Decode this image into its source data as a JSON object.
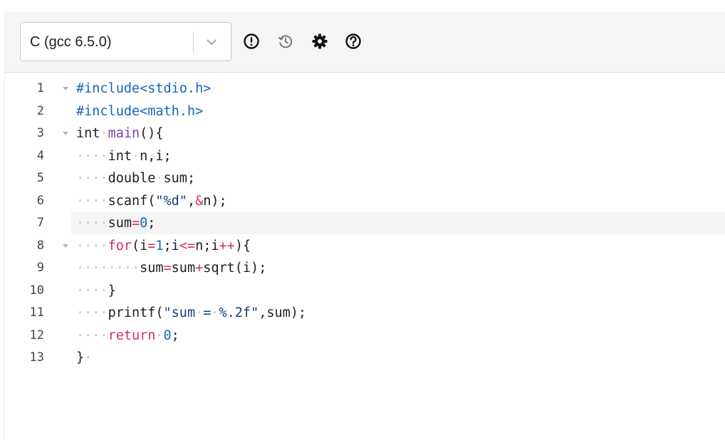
{
  "toolbar": {
    "language_select": {
      "value": "C (gcc 6.5.0)",
      "chevron_icon": "chevron-down-icon"
    },
    "icons": [
      {
        "name": "info-icon",
        "semantic": "alert-circle"
      },
      {
        "name": "history-icon",
        "semantic": "history"
      },
      {
        "name": "gear-icon",
        "semantic": "settings"
      },
      {
        "name": "help-icon",
        "semantic": "question-circle"
      }
    ]
  },
  "editor": {
    "active_line": 7,
    "lines": [
      {
        "num": "1",
        "fold": true,
        "tokens": [
          {
            "t": "#include<stdio.h>",
            "c": "pre"
          }
        ]
      },
      {
        "num": "2",
        "fold": false,
        "tokens": [
          {
            "t": "#include<math.h>",
            "c": "pre"
          }
        ]
      },
      {
        "num": "3",
        "fold": true,
        "tokens": [
          {
            "t": "int",
            "c": "plain"
          },
          {
            "t": "·",
            "c": "ws"
          },
          {
            "t": "main",
            "c": "fn"
          },
          {
            "t": "(){",
            "c": "plain"
          }
        ]
      },
      {
        "num": "4",
        "fold": false,
        "tokens": [
          {
            "t": "····",
            "c": "ws"
          },
          {
            "t": "int",
            "c": "plain"
          },
          {
            "t": "·",
            "c": "ws"
          },
          {
            "t": "n,i;",
            "c": "plain"
          }
        ]
      },
      {
        "num": "5",
        "fold": false,
        "tokens": [
          {
            "t": "····",
            "c": "ws"
          },
          {
            "t": "double",
            "c": "plain"
          },
          {
            "t": "·",
            "c": "ws"
          },
          {
            "t": "sum;",
            "c": "plain"
          }
        ]
      },
      {
        "num": "6",
        "fold": false,
        "tokens": [
          {
            "t": "····",
            "c": "ws"
          },
          {
            "t": "scanf(",
            "c": "plain"
          },
          {
            "t": "\"%d\"",
            "c": "str"
          },
          {
            "t": ",",
            "c": "plain"
          },
          {
            "t": "&",
            "c": "op"
          },
          {
            "t": "n);",
            "c": "plain"
          }
        ]
      },
      {
        "num": "7",
        "fold": false,
        "tokens": [
          {
            "t": "····",
            "c": "ws"
          },
          {
            "t": "sum",
            "c": "plain"
          },
          {
            "t": "=",
            "c": "op"
          },
          {
            "t": "0",
            "c": "num"
          },
          {
            "t": ";",
            "c": "plain"
          }
        ]
      },
      {
        "num": "8",
        "fold": true,
        "tokens": [
          {
            "t": "····",
            "c": "ws"
          },
          {
            "t": "for",
            "c": "kw"
          },
          {
            "t": "(i",
            "c": "plain"
          },
          {
            "t": "=",
            "c": "op"
          },
          {
            "t": "1",
            "c": "num"
          },
          {
            "t": ";i",
            "c": "plain"
          },
          {
            "t": "<=",
            "c": "op"
          },
          {
            "t": "n;i",
            "c": "plain"
          },
          {
            "t": "++",
            "c": "op"
          },
          {
            "t": "){",
            "c": "plain"
          }
        ]
      },
      {
        "num": "9",
        "fold": false,
        "tokens": [
          {
            "t": "········",
            "c": "ws"
          },
          {
            "t": "sum",
            "c": "plain"
          },
          {
            "t": "=",
            "c": "op"
          },
          {
            "t": "sum",
            "c": "plain"
          },
          {
            "t": "+",
            "c": "op"
          },
          {
            "t": "sqrt(i);",
            "c": "plain"
          }
        ]
      },
      {
        "num": "10",
        "fold": false,
        "tokens": [
          {
            "t": "····",
            "c": "ws"
          },
          {
            "t": "}",
            "c": "plain"
          }
        ]
      },
      {
        "num": "11",
        "fold": false,
        "tokens": [
          {
            "t": "····",
            "c": "ws"
          },
          {
            "t": "printf(",
            "c": "plain"
          },
          {
            "t": "\"sum",
            "c": "str"
          },
          {
            "t": "·",
            "c": "ws"
          },
          {
            "t": "=",
            "c": "str"
          },
          {
            "t": "·",
            "c": "ws"
          },
          {
            "t": "%.2f\"",
            "c": "str"
          },
          {
            "t": ",sum);",
            "c": "plain"
          }
        ]
      },
      {
        "num": "12",
        "fold": false,
        "tokens": [
          {
            "t": "····",
            "c": "ws"
          },
          {
            "t": "return",
            "c": "kw"
          },
          {
            "t": "·",
            "c": "ws"
          },
          {
            "t": "0",
            "c": "num"
          },
          {
            "t": ";",
            "c": "plain"
          }
        ]
      },
      {
        "num": "13",
        "fold": false,
        "tokens": [
          {
            "t": "}",
            "c": "plain"
          },
          {
            "t": "·",
            "c": "ws"
          }
        ]
      }
    ]
  }
}
